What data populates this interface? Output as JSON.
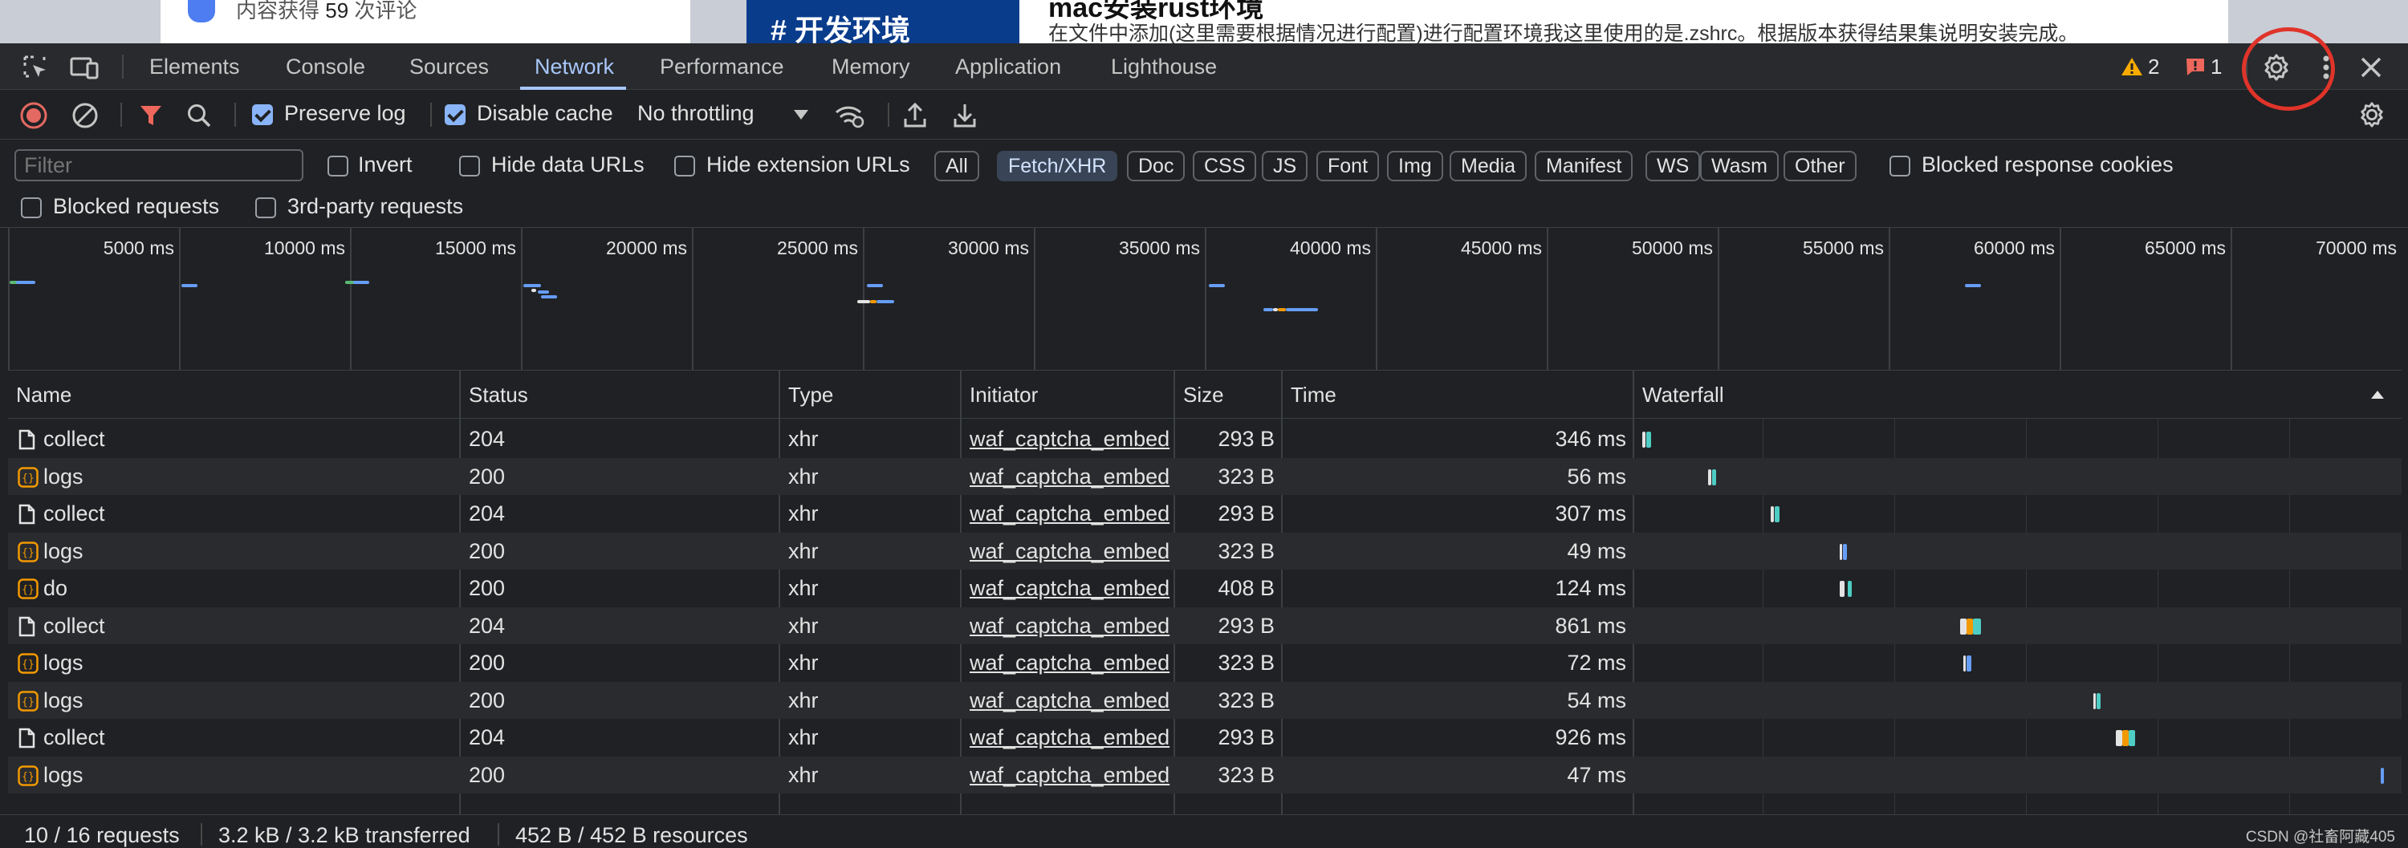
{
  "background": {
    "left_text_prefix": "内容获得",
    "left_text_count": "59",
    "left_text_suffix": "次评论",
    "hero_text": "# 开发环境",
    "title": "mac安装rust环境",
    "body_text": "在文件中添加(这里需要根据情况进行配置)进行配置环境我这里使用的是.zshrc。根据版本获得结果集说明安装完成。"
  },
  "tabs": [
    "Elements",
    "Console",
    "Sources",
    "Network",
    "Performance",
    "Memory",
    "Application",
    "Lighthouse"
  ],
  "active_tab": "Network",
  "badges": {
    "warnings": "2",
    "issues": "1"
  },
  "toolbar": {
    "preserve_log": "Preserve log",
    "disable_cache": "Disable cache",
    "throttling": "No throttling"
  },
  "filter": {
    "placeholder": "Filter",
    "invert": "Invert",
    "hide_data_urls": "Hide data URLs",
    "hide_extension_urls": "Hide extension URLs",
    "types": [
      "All",
      "Fetch/XHR",
      "Doc",
      "CSS",
      "JS",
      "Font",
      "Img",
      "Media",
      "Manifest",
      "WS",
      "Wasm",
      "Other"
    ],
    "selected_type": "Fetch/XHR",
    "blocked_response_cookies": "Blocked response cookies",
    "blocked_requests": "Blocked requests",
    "third_party": "3rd-party requests"
  },
  "overview_ticks": [
    "5000 ms",
    "10000 ms",
    "15000 ms",
    "20000 ms",
    "25000 ms",
    "30000 ms",
    "35000 ms",
    "40000 ms",
    "45000 ms",
    "50000 ms",
    "55000 ms",
    "60000 ms",
    "65000 ms",
    "70000 ms"
  ],
  "columns": [
    "Name",
    "Status",
    "Type",
    "Initiator",
    "Size",
    "Time",
    "Waterfall"
  ],
  "rows": [
    {
      "name": "collect",
      "icon": "document-icon",
      "status": "204",
      "type": "xhr",
      "initiator": "waf_captcha_embed",
      "size": "293 B",
      "time": "346 ms"
    },
    {
      "name": "logs",
      "icon": "fetch-icon",
      "status": "200",
      "type": "xhr",
      "initiator": "waf_captcha_embed",
      "size": "323 B",
      "time": "56 ms"
    },
    {
      "name": "collect",
      "icon": "document-icon",
      "status": "204",
      "type": "xhr",
      "initiator": "waf_captcha_embed",
      "size": "293 B",
      "time": "307 ms"
    },
    {
      "name": "logs",
      "icon": "fetch-icon",
      "status": "200",
      "type": "xhr",
      "initiator": "waf_captcha_embed",
      "size": "323 B",
      "time": "49 ms"
    },
    {
      "name": "do",
      "icon": "fetch-icon",
      "status": "200",
      "type": "xhr",
      "initiator": "waf_captcha_embed",
      "size": "408 B",
      "time": "124 ms"
    },
    {
      "name": "collect",
      "icon": "document-icon",
      "status": "204",
      "type": "xhr",
      "initiator": "waf_captcha_embed",
      "size": "293 B",
      "time": "861 ms"
    },
    {
      "name": "logs",
      "icon": "fetch-icon",
      "status": "200",
      "type": "xhr",
      "initiator": "waf_captcha_embed",
      "size": "323 B",
      "time": "72 ms"
    },
    {
      "name": "logs",
      "icon": "fetch-icon",
      "status": "200",
      "type": "xhr",
      "initiator": "waf_captcha_embed",
      "size": "323 B",
      "time": "54 ms"
    },
    {
      "name": "collect",
      "icon": "document-icon",
      "status": "204",
      "type": "xhr",
      "initiator": "waf_captcha_embed",
      "size": "293 B",
      "time": "926 ms"
    },
    {
      "name": "logs",
      "icon": "fetch-icon",
      "status": "200",
      "type": "xhr",
      "initiator": "waf_captcha_embed",
      "size": "323 B",
      "time": "47 ms"
    }
  ],
  "status": {
    "requests": "10 / 16 requests",
    "transferred": "3.2 kB / 3.2 kB transferred",
    "resources": "452 B / 452 B resources"
  },
  "watermark": "CSDN @社畜阿藏405",
  "colors": {
    "accent": "#a8c7fa",
    "record": "#e46962",
    "filter_active": "#ee675c",
    "warning": "#f9ab00",
    "highlight": "#e0342a"
  }
}
